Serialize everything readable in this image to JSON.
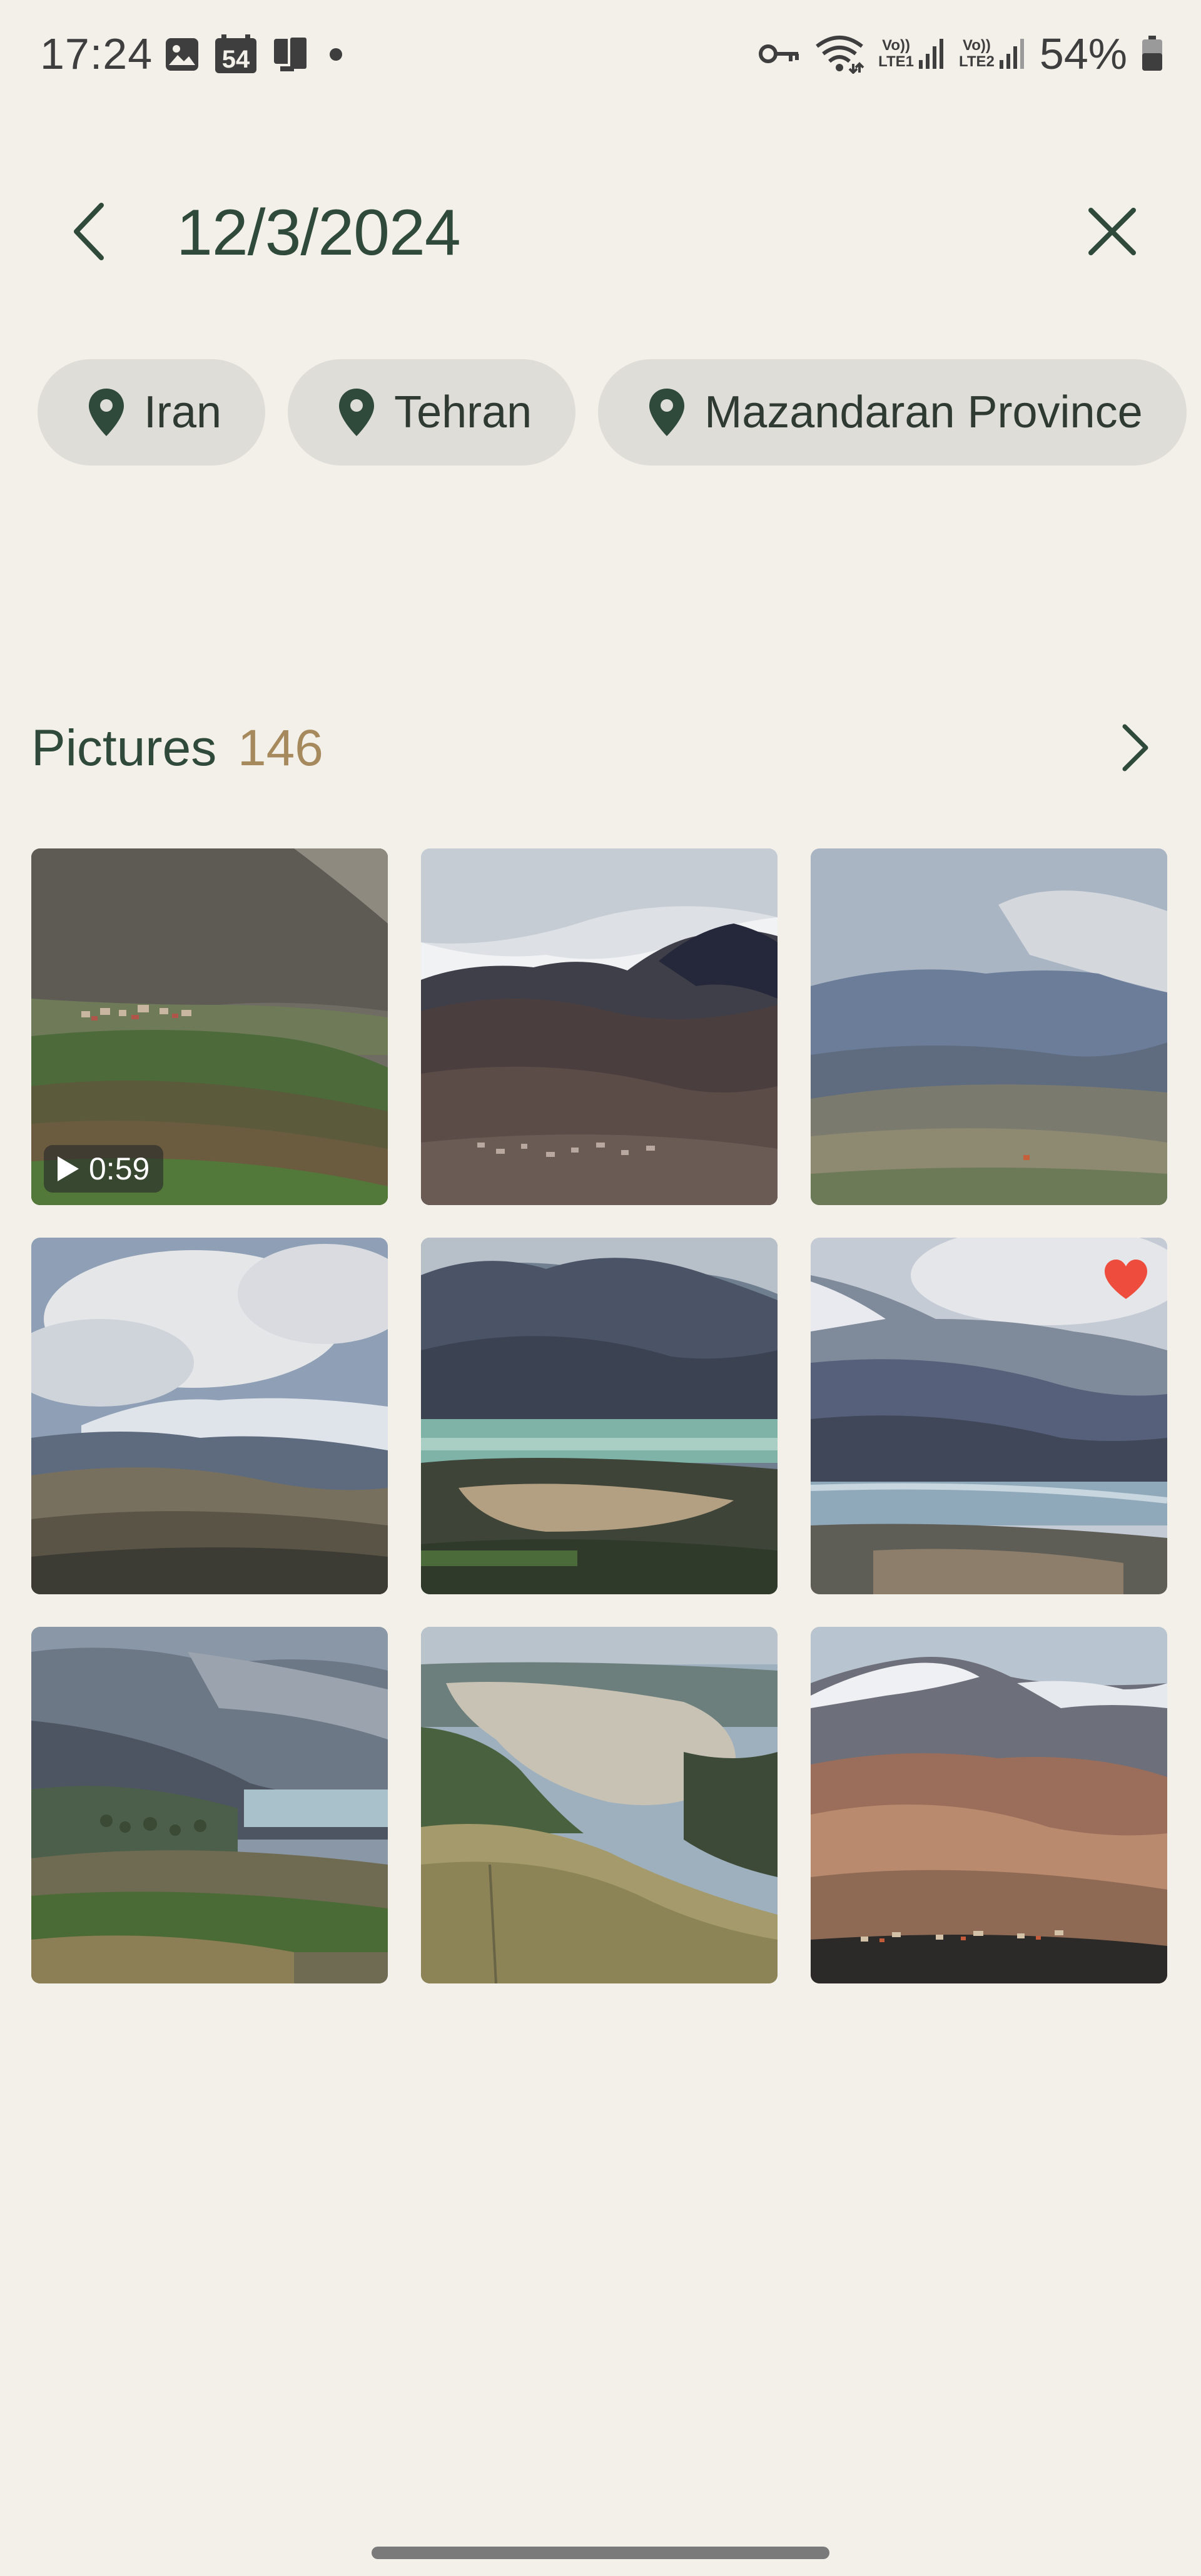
{
  "status_bar": {
    "time": "17:24",
    "notification_icons": [
      "gallery-icon",
      "calendar-54-icon",
      "device-icon",
      "dot-icon"
    ],
    "system_icons": [
      "vpn-key-icon",
      "wifi-icon",
      "volte1-signal-icon",
      "volte2-signal-icon",
      "battery-icon"
    ],
    "calendar_badge": "54",
    "sim1_label": "LTE1",
    "sim2_label": "LTE2",
    "volte_label": "Vo))",
    "battery_percent": "54%"
  },
  "header": {
    "title": "12/3/2024"
  },
  "locations": [
    {
      "label": "Iran"
    },
    {
      "label": "Tehran"
    },
    {
      "label": "Mazandaran Province"
    }
  ],
  "section": {
    "title": "Pictures",
    "count": "146"
  },
  "thumbnails": [
    {
      "type": "video",
      "duration": "0:59"
    },
    {
      "type": "photo"
    },
    {
      "type": "photo"
    },
    {
      "type": "photo"
    },
    {
      "type": "photo"
    },
    {
      "type": "photo",
      "favorite": true
    },
    {
      "type": "photo"
    },
    {
      "type": "photo"
    },
    {
      "type": "photo"
    }
  ],
  "colors": {
    "background": "#f3f0ea",
    "chip_background": "#deddd7",
    "title_green": "#2f4a3a",
    "count_tan": "#a6895d",
    "favorite_red": "#ee4c3c"
  }
}
